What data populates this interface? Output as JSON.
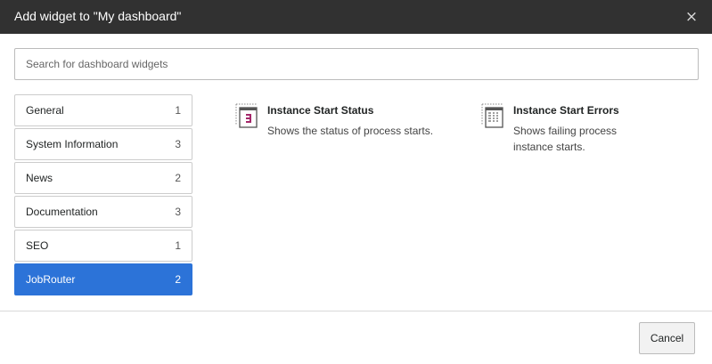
{
  "header": {
    "title": "Add widget to \"My dashboard\"",
    "close_label": "×"
  },
  "search": {
    "placeholder": "Search for dashboard widgets",
    "value": ""
  },
  "categories": [
    {
      "label": "General",
      "count": "1",
      "active": false
    },
    {
      "label": "System Information",
      "count": "3",
      "active": false
    },
    {
      "label": "News",
      "count": "2",
      "active": false
    },
    {
      "label": "Documentation",
      "count": "3",
      "active": false
    },
    {
      "label": "SEO",
      "count": "1",
      "active": false
    },
    {
      "label": "JobRouter",
      "count": "2",
      "active": true
    }
  ],
  "widgets": [
    {
      "title": "Instance Start Status",
      "description_lines": [
        "Shows the status of process starts."
      ],
      "icon": "instance-status-icon"
    },
    {
      "title": "Instance Start Errors",
      "description_lines": [
        "Shows failing process",
        "instance starts."
      ],
      "icon": "instance-errors-icon"
    }
  ],
  "footer": {
    "cancel_label": "Cancel"
  },
  "colors": {
    "header_bg": "#313131",
    "active_bg": "#2c73d8",
    "icon_accent": "#a4276a"
  }
}
